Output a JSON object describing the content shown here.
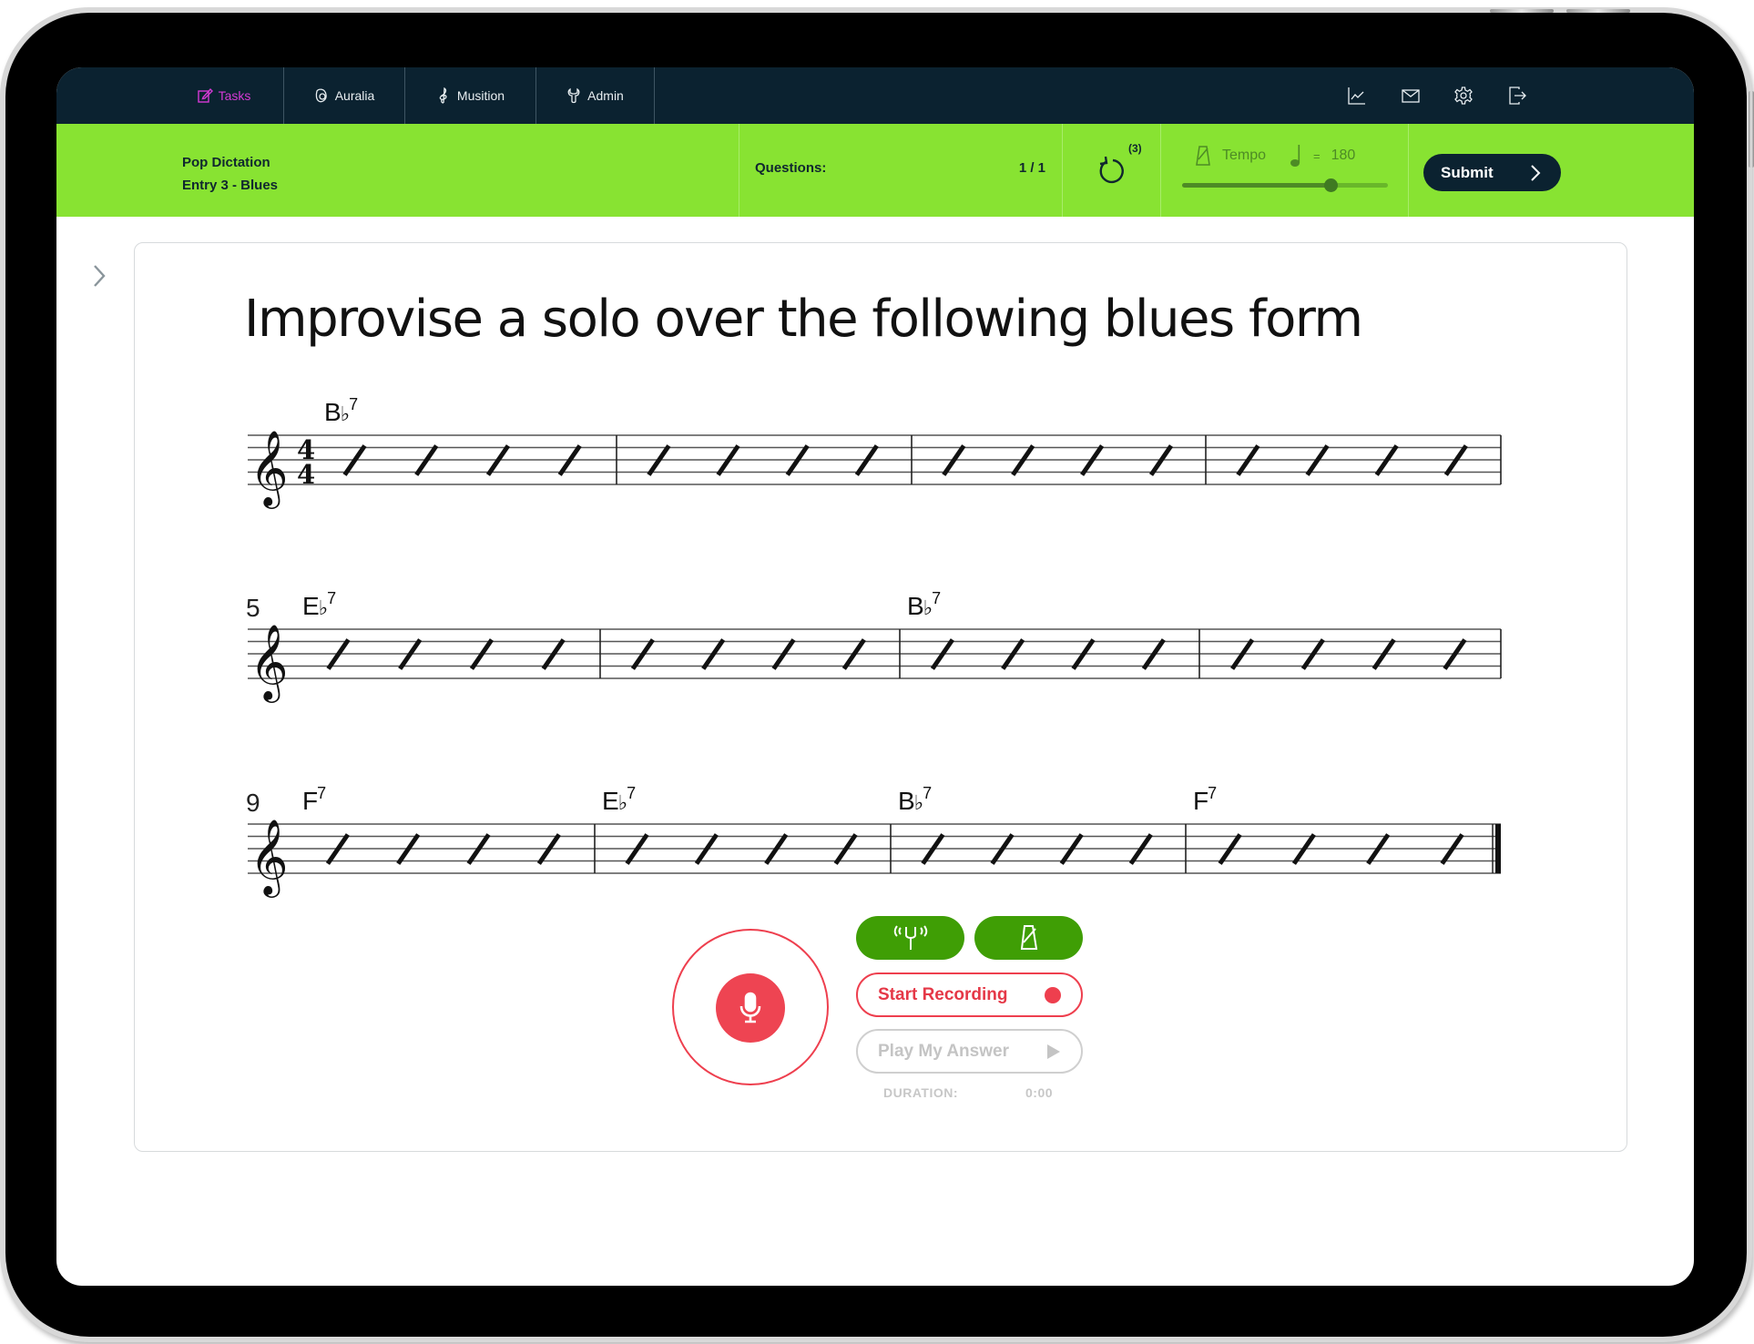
{
  "nav": {
    "tabs": [
      {
        "label": "Tasks",
        "icon": "edit-icon",
        "active": true
      },
      {
        "label": "Auralia",
        "icon": "ear-icon",
        "active": false
      },
      {
        "label": "Musition",
        "icon": "treble-clef-icon",
        "active": false
      },
      {
        "label": "Admin",
        "icon": "wrench-icon",
        "active": false
      }
    ],
    "right_icons": [
      "chart-icon",
      "mail-icon",
      "settings-icon",
      "logout-icon"
    ]
  },
  "task": {
    "course": "Pop Dictation",
    "entry": "Entry 3 - Blues",
    "questions_label": "Questions:",
    "questions_value": "1 / 1",
    "attempts": "(3)",
    "tempo_label": "Tempo",
    "tempo_eq": "=",
    "tempo_value": "180",
    "tempo_slider_fraction": 0.72,
    "submit_label": "Submit"
  },
  "content": {
    "title": "Improvise a solo over the following blues form",
    "time_signature": "4/4",
    "rows": [
      {
        "measure_number": "",
        "chords": [
          {
            "measure": 0,
            "root": "B",
            "acc": "♭",
            "ext": "7"
          }
        ]
      },
      {
        "measure_number": "5",
        "chords": [
          {
            "measure": 0,
            "root": "E",
            "acc": "♭",
            "ext": "7"
          },
          {
            "measure": 2,
            "root": "B",
            "acc": "♭",
            "ext": "7"
          }
        ]
      },
      {
        "measure_number": "9",
        "chords": [
          {
            "measure": 0,
            "root": "F",
            "acc": "",
            "ext": "7"
          },
          {
            "measure": 1,
            "root": "E",
            "acc": "♭",
            "ext": "7"
          },
          {
            "measure": 2,
            "root": "B",
            "acc": "♭",
            "ext": "7"
          },
          {
            "measure": 3,
            "root": "F",
            "acc": "",
            "ext": "7"
          }
        ]
      }
    ]
  },
  "recorder": {
    "start_label": "Start Recording",
    "play_label": "Play My Answer",
    "duration_label": "DURATION:",
    "duration_value": "0:00",
    "colors": {
      "record": "#ee3f4e",
      "tool_green": "#3f9e05"
    }
  }
}
